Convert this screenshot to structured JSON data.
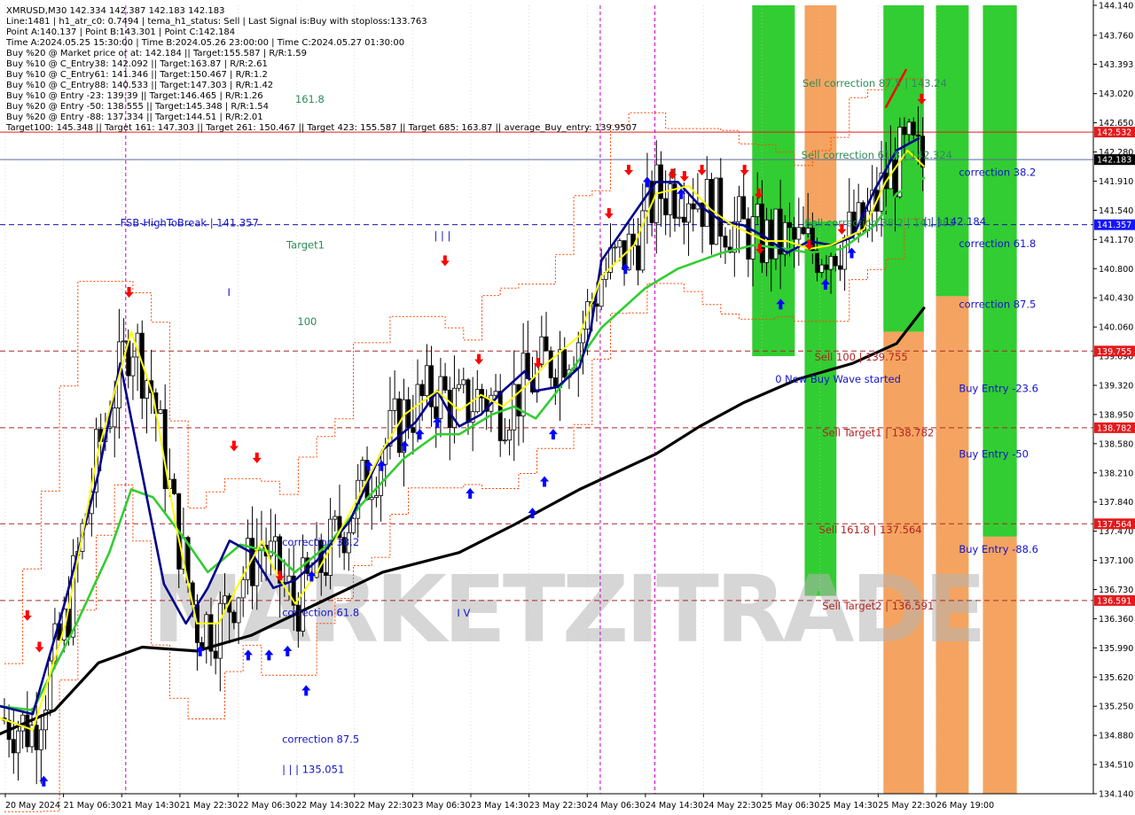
{
  "colors": {
    "background": "#ffffff",
    "grid": "#c8c8c8",
    "candle": "#000000",
    "wma_black": "#000000",
    "ma_green": "#32cd32",
    "ma_navy": "#00008b",
    "ma_yellow": "#ffff00",
    "envelope": "#ff4500",
    "zone_green": "#32cd32",
    "zone_orange": "#f4a460",
    "buy_arrow": "#0000ff",
    "sell_arrow": "#ff0000",
    "price_tag_red": "#e31a1c",
    "price_tag_blue": "#1414ff",
    "price_tag_current": "#000000",
    "label_blue": "#1414cc",
    "label_red": "#b22222",
    "label_green": "#2e8b57",
    "session_line": "#c800c8",
    "watermark": "#b4b4b4"
  },
  "info": {
    "lines": [
      "XMRUSD,M30  142.334 142.387 142.183 142.183",
      "Line:1481 | h1_atr_c0: 0.7494 | tema_h1_status: Sell | Last Signal is:Buy with stoploss:133.763",
      "Point A:140.137 | Point B:143.301 | Point C:142.184",
      "Time A:2024.05.25 15:30:00 | Time B:2024.05.26 23:00:00 | Time C:2024.05.27 01:30:00",
      "Buy %20 @ Market price or at: 142.184 || Target:155.587 | R/R:1.59",
      "Buy %10 @ C_Entry38: 142.092 || Target:163.87 | R/R:2.61",
      "Buy %10 @ C_Entry61: 141.346 || Target:150.467 | R/R:1.2",
      "Buy %10 @ C_Entry88: 140.533 || Target:147.303 | R/R:1.42",
      "Buy %10 @ Entry -23: 139.39 || Target:146.465 | R/R:1.26",
      "Buy %20 @ Entry -50: 138.555 || Target:145.348 | R/R:1.54",
      "Buy %20 @ Entry -88: 137.334 || Target:144.51 | R/R:2.01",
      "Target100: 145.348 || Target 161: 147.303 || Target 261: 150.467 || Target 423: 155.587 || Target 685: 163.87 || average_Buy_entry: 139.9507"
    ]
  },
  "watermark": "MARKETZITRADE",
  "chart_data": {
    "type": "candlestick",
    "symbol": "XMRUSD",
    "timeframe": "M30",
    "ylim": [
      134.14,
      144.14
    ],
    "y_ticks": [
      "144.140",
      "143.760",
      "143.393",
      "143.020",
      "142.650",
      "142.280",
      "141.910",
      "141.540",
      "141.170",
      "140.800",
      "140.430",
      "140.060",
      "139.690",
      "139.320",
      "138.950",
      "138.580",
      "138.210",
      "137.840",
      "137.470",
      "137.100",
      "136.730",
      "136.360",
      "135.990",
      "135.620",
      "135.250",
      "134.880",
      "134.510",
      "134.140"
    ],
    "x_ticks": [
      "20 May 2024",
      "21 May 06:30",
      "21 May 14:30",
      "21 May 22:30",
      "22 May 06:30",
      "22 May 14:30",
      "22 May 22:30",
      "23 May 06:30",
      "23 May 14:30",
      "23 May 22:30",
      "24 May 06:30",
      "24 May 14:30",
      "24 May 22:30",
      "25 May 06:30",
      "25 May 14:30",
      "25 May 22:30",
      "26 May 19:00"
    ],
    "price_tags": [
      {
        "text": "142.532",
        "value": 142.532,
        "kind": "red"
      },
      {
        "text": "142.183",
        "value": 142.183,
        "kind": "current"
      },
      {
        "text": "141.357",
        "value": 141.357,
        "kind": "blue"
      },
      {
        "text": "139.755",
        "value": 139.755,
        "kind": "red"
      },
      {
        "text": "138.782",
        "value": 138.782,
        "kind": "red"
      },
      {
        "text": "137.564",
        "value": 137.564,
        "kind": "red"
      },
      {
        "text": "136.591",
        "value": 136.591,
        "kind": "red"
      }
    ],
    "levels": [
      {
        "value": 142.532,
        "style": "solid",
        "color": "#e31a1c"
      },
      {
        "value": 142.183,
        "style": "solid",
        "color": "#5a6a9a"
      },
      {
        "value": 141.357,
        "style": "dash",
        "color": "#1414aa"
      },
      {
        "value": 139.755,
        "style": "dash",
        "color": "#a52a2a"
      },
      {
        "value": 138.782,
        "style": "dash",
        "color": "#a52a2a"
      },
      {
        "value": 137.564,
        "style": "dash",
        "color": "#a52a2a"
      },
      {
        "value": 136.591,
        "style": "dash",
        "color": "#a52a2a"
      }
    ],
    "zones": [
      {
        "color": "green",
        "t0": 0.688,
        "t1": 0.727,
        "top": 144.14,
        "bottom": 139.69
      },
      {
        "color": "orange",
        "t0": 0.736,
        "t1": 0.765,
        "top": 144.14,
        "bottom": 141.4
      },
      {
        "color": "green",
        "t0": 0.736,
        "t1": 0.765,
        "top": 141.4,
        "bottom": 136.65
      },
      {
        "color": "green",
        "t0": 0.808,
        "t1": 0.845,
        "top": 144.14,
        "bottom": 140.0
      },
      {
        "color": "orange",
        "t0": 0.808,
        "t1": 0.845,
        "top": 140.0,
        "bottom": 134.14
      },
      {
        "color": "green",
        "t0": 0.856,
        "t1": 0.886,
        "top": 144.14,
        "bottom": 140.45
      },
      {
        "color": "orange",
        "t0": 0.856,
        "t1": 0.886,
        "top": 140.45,
        "bottom": 134.14
      },
      {
        "color": "green",
        "t0": 0.899,
        "t1": 0.93,
        "top": 144.14,
        "bottom": 137.4
      },
      {
        "color": "orange",
        "t0": 0.899,
        "t1": 0.93,
        "top": 137.4,
        "bottom": 134.14
      }
    ],
    "session_lines": [
      0.115,
      0.549,
      0.599
    ],
    "series": [
      {
        "name": "wma_black",
        "points": [
          [
            0.0,
            134.9
          ],
          [
            0.05,
            135.2
          ],
          [
            0.09,
            135.8
          ],
          [
            0.13,
            136.0
          ],
          [
            0.18,
            135.95
          ],
          [
            0.23,
            136.15
          ],
          [
            0.29,
            136.55
          ],
          [
            0.35,
            136.95
          ],
          [
            0.42,
            137.2
          ],
          [
            0.47,
            137.55
          ],
          [
            0.53,
            138.0
          ],
          [
            0.6,
            138.45
          ],
          [
            0.64,
            138.8
          ],
          [
            0.68,
            139.1
          ],
          [
            0.73,
            139.4
          ],
          [
            0.78,
            139.6
          ],
          [
            0.82,
            139.85
          ],
          [
            0.845,
            140.3
          ]
        ]
      },
      {
        "name": "ma_green",
        "points": [
          [
            0.0,
            135.25
          ],
          [
            0.03,
            135.2
          ],
          [
            0.07,
            136.3
          ],
          [
            0.1,
            137.2
          ],
          [
            0.12,
            138.0
          ],
          [
            0.14,
            137.9
          ],
          [
            0.17,
            137.35
          ],
          [
            0.19,
            136.95
          ],
          [
            0.22,
            137.3
          ],
          [
            0.25,
            137.2
          ],
          [
            0.27,
            136.95
          ],
          [
            0.3,
            137.3
          ],
          [
            0.33,
            137.8
          ],
          [
            0.37,
            138.4
          ],
          [
            0.4,
            138.7
          ],
          [
            0.42,
            138.7
          ],
          [
            0.45,
            138.95
          ],
          [
            0.47,
            139.05
          ],
          [
            0.49,
            138.9
          ],
          [
            0.51,
            139.25
          ],
          [
            0.55,
            140.05
          ],
          [
            0.59,
            140.55
          ],
          [
            0.62,
            140.8
          ],
          [
            0.66,
            141.0
          ],
          [
            0.69,
            141.1
          ],
          [
            0.72,
            141.05
          ],
          [
            0.74,
            141.0
          ],
          [
            0.77,
            141.05
          ],
          [
            0.8,
            141.35
          ],
          [
            0.82,
            141.75
          ],
          [
            0.845,
            141.95
          ]
        ]
      },
      {
        "name": "ma_navy",
        "points": [
          [
            0.0,
            135.25
          ],
          [
            0.03,
            135.15
          ],
          [
            0.06,
            136.6
          ],
          [
            0.09,
            138.2
          ],
          [
            0.11,
            139.6
          ],
          [
            0.13,
            138.2
          ],
          [
            0.15,
            136.8
          ],
          [
            0.17,
            136.3
          ],
          [
            0.19,
            136.75
          ],
          [
            0.21,
            137.35
          ],
          [
            0.23,
            137.2
          ],
          [
            0.25,
            136.75
          ],
          [
            0.27,
            136.85
          ],
          [
            0.29,
            137.1
          ],
          [
            0.32,
            137.6
          ],
          [
            0.35,
            138.5
          ],
          [
            0.38,
            138.85
          ],
          [
            0.4,
            139.25
          ],
          [
            0.41,
            139.0
          ],
          [
            0.42,
            138.8
          ],
          [
            0.44,
            138.95
          ],
          [
            0.46,
            139.25
          ],
          [
            0.48,
            139.5
          ],
          [
            0.49,
            139.25
          ],
          [
            0.51,
            139.3
          ],
          [
            0.53,
            139.55
          ],
          [
            0.54,
            140.0
          ],
          [
            0.55,
            140.9
          ],
          [
            0.58,
            141.5
          ],
          [
            0.6,
            141.9
          ],
          [
            0.62,
            141.9
          ],
          [
            0.64,
            141.6
          ],
          [
            0.66,
            141.4
          ],
          [
            0.68,
            141.35
          ],
          [
            0.7,
            141.2
          ],
          [
            0.72,
            141.0
          ],
          [
            0.74,
            141.15
          ],
          [
            0.76,
            141.1
          ],
          [
            0.78,
            141.2
          ],
          [
            0.8,
            141.8
          ],
          [
            0.82,
            142.3
          ],
          [
            0.84,
            142.45
          ]
        ]
      },
      {
        "name": "ma_yellow",
        "points": [
          [
            0.0,
            135.1
          ],
          [
            0.03,
            134.95
          ],
          [
            0.06,
            136.3
          ],
          [
            0.09,
            138.5
          ],
          [
            0.12,
            140.0
          ],
          [
            0.14,
            139.2
          ],
          [
            0.16,
            137.6
          ],
          [
            0.18,
            136.3
          ],
          [
            0.2,
            136.3
          ],
          [
            0.22,
            136.85
          ],
          [
            0.24,
            137.35
          ],
          [
            0.25,
            137.0
          ],
          [
            0.27,
            136.55
          ],
          [
            0.29,
            136.95
          ],
          [
            0.32,
            137.7
          ],
          [
            0.35,
            138.5
          ],
          [
            0.37,
            138.95
          ],
          [
            0.4,
            139.25
          ],
          [
            0.42,
            139.0
          ],
          [
            0.44,
            139.2
          ],
          [
            0.46,
            139.05
          ],
          [
            0.48,
            139.3
          ],
          [
            0.5,
            139.6
          ],
          [
            0.53,
            139.95
          ],
          [
            0.55,
            140.7
          ],
          [
            0.58,
            141.1
          ],
          [
            0.6,
            141.75
          ],
          [
            0.63,
            141.85
          ],
          [
            0.65,
            141.55
          ],
          [
            0.67,
            141.35
          ],
          [
            0.7,
            141.15
          ],
          [
            0.72,
            141.15
          ],
          [
            0.74,
            141.05
          ],
          [
            0.76,
            141.1
          ],
          [
            0.79,
            141.3
          ],
          [
            0.81,
            141.9
          ],
          [
            0.83,
            142.3
          ],
          [
            0.845,
            142.1
          ]
        ]
      }
    ],
    "annotations": [
      {
        "text": "161.8",
        "t": 0.27,
        "v": 142.95,
        "color": "green"
      },
      {
        "text": "Target1",
        "t": 0.262,
        "v": 141.1,
        "color": "green"
      },
      {
        "text": "100",
        "t": 0.272,
        "v": 140.13,
        "color": "green"
      },
      {
        "text": "FSB-HighToBreak | 141.357",
        "t": 0.11,
        "v": 141.38,
        "color": "blue"
      },
      {
        "text": "| | |",
        "t": 0.397,
        "v": 141.22,
        "color": "blue"
      },
      {
        "text": "I",
        "t": 0.208,
        "v": 140.5,
        "color": "blue"
      },
      {
        "text": "I V",
        "t": 0.418,
        "v": 136.43,
        "color": "blue"
      },
      {
        "text": "correction 38.2",
        "t": 0.258,
        "v": 137.33,
        "color": "blue"
      },
      {
        "text": "correction 61.8",
        "t": 0.258,
        "v": 136.44,
        "color": "blue"
      },
      {
        "text": "correction 87.5",
        "t": 0.258,
        "v": 134.83,
        "color": "blue"
      },
      {
        "text": "| | | 135.051",
        "t": 0.258,
        "v": 134.45,
        "color": "blue"
      },
      {
        "text": "Sell correction 87.5 | 143.24",
        "t": 0.734,
        "v": 143.15,
        "color": "green"
      },
      {
        "text": "Sell correction 61.8 | 142.324",
        "t": 0.733,
        "v": 142.24,
        "color": "green"
      },
      {
        "text": "Sell correction 38.2 | 141.382",
        "t": 0.736,
        "v": 141.38,
        "color": "green"
      },
      {
        "text": "| | | 142.184",
        "t": 0.845,
        "v": 141.4,
        "color": "blue"
      },
      {
        "text": "correction 38.2",
        "t": 0.877,
        "v": 142.02,
        "color": "blue"
      },
      {
        "text": "correction 61.8",
        "t": 0.877,
        "v": 141.12,
        "color": "blue"
      },
      {
        "text": "correction 87.5",
        "t": 0.877,
        "v": 140.35,
        "color": "blue"
      },
      {
        "text": "Sell 100 | 139.755",
        "t": 0.745,
        "v": 139.68,
        "color": "red"
      },
      {
        "text": "0 New Buy Wave started",
        "t": 0.709,
        "v": 139.4,
        "color": "blue"
      },
      {
        "text": "Buy Entry -23.6",
        "t": 0.877,
        "v": 139.28,
        "color": "blue"
      },
      {
        "text": "Sell Target1 | 138.782",
        "t": 0.752,
        "v": 138.72,
        "color": "red"
      },
      {
        "text": "Buy Entry -50",
        "t": 0.877,
        "v": 138.45,
        "color": "blue"
      },
      {
        "text": "Sell 161.8 | 137.564",
        "t": 0.749,
        "v": 137.49,
        "color": "red"
      },
      {
        "text": "Buy Entry -88.6",
        "t": 0.877,
        "v": 137.24,
        "color": "blue"
      },
      {
        "text": "Sell Target2 | 136.591",
        "t": 0.752,
        "v": 136.52,
        "color": "red"
      }
    ],
    "buy_arrows": [
      [
        0.04,
        134.3
      ],
      [
        0.183,
        135.95
      ],
      [
        0.227,
        135.9
      ],
      [
        0.246,
        135.9
      ],
      [
        0.263,
        135.95
      ],
      [
        0.28,
        135.45
      ],
      [
        0.285,
        136.9
      ],
      [
        0.337,
        138.3
      ],
      [
        0.349,
        138.3
      ],
      [
        0.37,
        138.55
      ],
      [
        0.384,
        138.7
      ],
      [
        0.4,
        138.85
      ],
      [
        0.43,
        137.95
      ],
      [
        0.487,
        137.7
      ],
      [
        0.498,
        138.1
      ],
      [
        0.506,
        138.7
      ],
      [
        0.572,
        140.8
      ],
      [
        0.592,
        141.9
      ],
      [
        0.623,
        141.75
      ],
      [
        0.714,
        140.35
      ],
      [
        0.755,
        140.6
      ],
      [
        0.779,
        141.0
      ]
    ],
    "sell_arrows": [
      [
        0.025,
        136.4
      ],
      [
        0.036,
        136.0
      ],
      [
        0.118,
        140.5
      ],
      [
        0.214,
        138.55
      ],
      [
        0.235,
        138.4
      ],
      [
        0.256,
        136.9
      ],
      [
        0.407,
        140.9
      ],
      [
        0.438,
        139.65
      ],
      [
        0.492,
        139.6
      ],
      [
        0.557,
        141.5
      ],
      [
        0.575,
        142.05
      ],
      [
        0.615,
        142.0
      ],
      [
        0.626,
        141.97
      ],
      [
        0.642,
        142.05
      ],
      [
        0.681,
        142.05
      ],
      [
        0.694,
        141.75
      ],
      [
        0.695,
        141.05
      ],
      [
        0.74,
        141.1
      ],
      [
        0.77,
        141.3
      ],
      [
        0.843,
        142.95
      ]
    ],
    "red_segment": [
      [
        0.81,
        142.84
      ],
      [
        0.829,
        143.33
      ]
    ]
  }
}
